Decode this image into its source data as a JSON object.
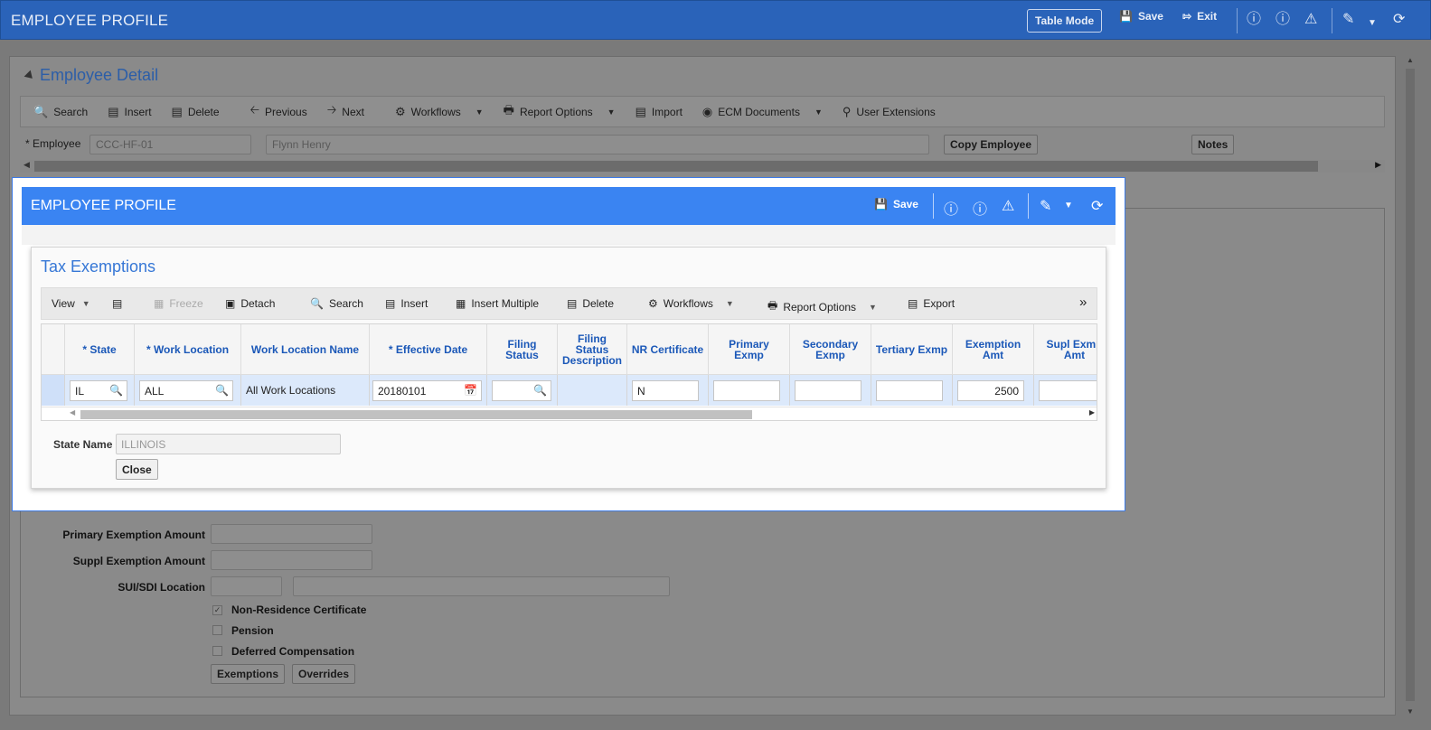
{
  "app": {
    "title": "EMPLOYEE PROFILE",
    "table_mode_label": "Table Mode",
    "save_label": "Save",
    "exit_label": "Exit"
  },
  "detail": {
    "title": "Employee Detail",
    "toolbar": {
      "search": "Search",
      "insert": "Insert",
      "delete": "Delete",
      "previous": "Previous",
      "next": "Next",
      "workflows": "Workflows",
      "report_options": "Report Options",
      "import": "Import",
      "ecm_documents": "ECM Documents",
      "user_extensions": "User Extensions"
    },
    "employee_label": "* Employee",
    "employee_id": "CCC-HF-01",
    "employee_name": "Flynn Henry",
    "copy_employee": "Copy Employee",
    "notes": "Notes"
  },
  "background_form": {
    "primary_exemption_label": "Primary Exemption Amount",
    "suppl_exemption_label": "Suppl Exemption Amount",
    "sui_sdi_label": "SUI/SDI Location",
    "checkboxes": [
      {
        "label": "Non-Residence Certificate",
        "checked": true
      },
      {
        "label": "Pension",
        "checked": false
      },
      {
        "label": "Deferred Compensation",
        "checked": false
      }
    ],
    "exemptions_button": "Exemptions",
    "overrides_button": "Overrides"
  },
  "modal": {
    "title": "EMPLOYEE PROFILE",
    "save_label": "Save",
    "section_title": "Tax Exemptions",
    "toolbar": {
      "view": "View",
      "freeze": "Freeze",
      "detach": "Detach",
      "search": "Search",
      "insert": "Insert",
      "insert_multiple": "Insert Multiple",
      "delete": "Delete",
      "workflows": "Workflows",
      "report_options": "Report Options",
      "export": "Export"
    },
    "columns": {
      "state": "* State",
      "work_location": "* Work Location",
      "work_location_name": "Work Location Name",
      "effective_date": "* Effective Date",
      "filing_status_1": "Filing",
      "filing_status_2": "Status",
      "fsd_1": "Filing",
      "fsd_2": "Status",
      "fsd_3": "Description",
      "nr_certificate": "NR Certificate",
      "primary_1": "Primary",
      "primary_2": "Exmp",
      "secondary_1": "Secondary",
      "secondary_2": "Exmp",
      "tertiary": "Tertiary Exmp",
      "exemption_1": "Exemption",
      "exemption_2": "Amt",
      "supl_1": "Supl Exmp",
      "supl_2": "Amt"
    },
    "row": {
      "state": "IL",
      "work_location": "ALL",
      "work_location_name": "All Work Locations",
      "effective_date": "20180101",
      "filing_status": "",
      "filing_status_description": "",
      "nr_certificate": "N",
      "primary_exmp": "",
      "secondary_exmp": "",
      "tertiary_exmp": "",
      "exemption_amt": "2500",
      "supl_exmp_amt": ""
    },
    "state_name_label": "State Name",
    "state_name_value": "ILLINOIS",
    "close_label": "Close"
  },
  "colors": {
    "app_header": "#2a63b9",
    "modal_header": "#3a84f2",
    "link_blue": "#3677d6",
    "selected_row": "#dce9fb"
  }
}
